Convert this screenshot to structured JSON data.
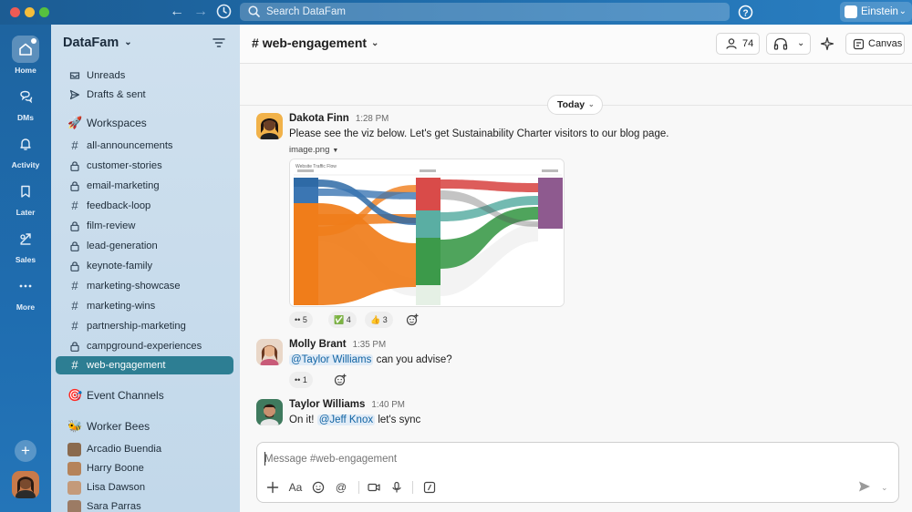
{
  "search": {
    "placeholder": "Search DataFam"
  },
  "workspace_switcher": {
    "label": "Einstein"
  },
  "rail": {
    "items": [
      {
        "label": "Home",
        "icon": "home-icon"
      },
      {
        "label": "DMs",
        "icon": "dms-icon"
      },
      {
        "label": "Activity",
        "icon": "bell-icon"
      },
      {
        "label": "Later",
        "icon": "bookmark-icon"
      },
      {
        "label": "Sales",
        "icon": "sales-icon"
      },
      {
        "label": "More",
        "icon": "more-icon"
      }
    ]
  },
  "sidebar": {
    "workspace_name": "DataFam",
    "top_items": [
      {
        "label": "Unreads",
        "icon": "unreads-icon"
      },
      {
        "label": "Drafts & sent",
        "icon": "send-icon"
      }
    ],
    "workspaces_label": "Workspaces",
    "channels": [
      {
        "label": "all-announcements",
        "icon": "hash-icon"
      },
      {
        "label": "customer-stories",
        "icon": "lock-icon"
      },
      {
        "label": "email-marketing",
        "icon": "lock-icon"
      },
      {
        "label": "feedback-loop",
        "icon": "hash-icon"
      },
      {
        "label": "film-review",
        "icon": "lock-icon"
      },
      {
        "label": "lead-generation",
        "icon": "lock-icon"
      },
      {
        "label": "keynote-family",
        "icon": "lock-icon"
      },
      {
        "label": "marketing-showcase",
        "icon": "hash-icon"
      },
      {
        "label": "marketing-wins",
        "icon": "hash-icon"
      },
      {
        "label": "partnership-marketing",
        "icon": "hash-icon"
      },
      {
        "label": "campground-experiences",
        "icon": "lock-icon"
      },
      {
        "label": "web-engagement",
        "icon": "hash-icon",
        "active": true
      }
    ],
    "event_channels_label": "Event Channels",
    "worker_bees_label": "Worker Bees",
    "people": [
      {
        "label": "Arcadio Buendia"
      },
      {
        "label": "Harry Boone"
      },
      {
        "label": "Lisa Dawson"
      },
      {
        "label": "Sara Parras"
      }
    ]
  },
  "channel": {
    "name": "web-engagement",
    "member_count": "74",
    "canvas_label": "Canvas"
  },
  "date_divider": "Today",
  "messages": [
    {
      "author": "Dakota Finn",
      "time": "1:28 PM",
      "text": "Please see the viz below. Let's get Sustainability Charter visitors to our blog page.",
      "attachment": "image.png",
      "attachment_title": "Website Traffic Flow",
      "reactions": [
        {
          "emoji": "eyes",
          "count": "5"
        },
        {
          "emoji": "✅",
          "count": "4"
        },
        {
          "emoji": "👍",
          "count": "3"
        }
      ]
    },
    {
      "author": "Molly Brant",
      "time": "1:35 PM",
      "mention": "@Taylor Williams",
      "text": "can you advise?",
      "reactions": [
        {
          "emoji": "eyes",
          "count": "1"
        }
      ]
    },
    {
      "author": "Taylor Williams",
      "time": "1:40 PM",
      "text_before": "On it!",
      "mention": "@Jeff Knox",
      "text_after": "let's sync"
    }
  ],
  "composer": {
    "placeholder": "Message #web-engagement"
  },
  "colors": {
    "accent": "#2d7e93",
    "rail": "#1f6db0",
    "sidebar": "#c9dcec"
  }
}
